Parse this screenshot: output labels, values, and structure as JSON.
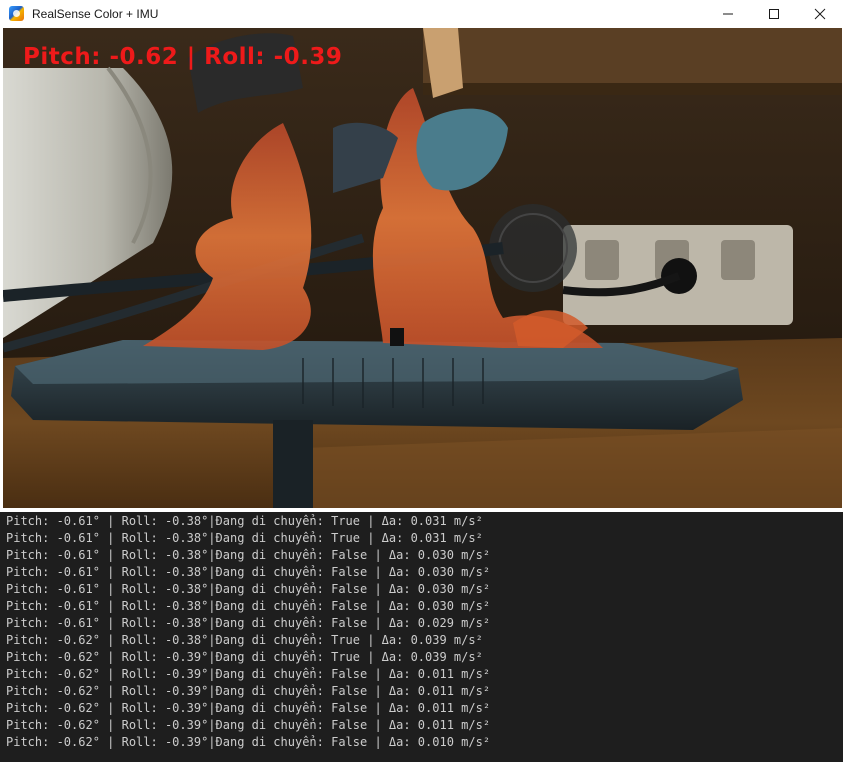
{
  "window": {
    "title": "RealSense Color + IMU",
    "controls": {
      "minimize_icon": "minimize-icon",
      "maximize_icon": "maximize-icon",
      "close_icon": "close-icon"
    }
  },
  "video": {
    "overlay": "Pitch: -0.62 | Roll: -0.39",
    "overlay_color": "#ee1a1a"
  },
  "console": {
    "lines": [
      "Pitch: -0.61° | Roll: -0.38°|Đang di chuyển: True | Δa: 0.031 m/s²",
      "Pitch: -0.61° | Roll: -0.38°|Đang di chuyển: True | Δa: 0.031 m/s²",
      "Pitch: -0.61° | Roll: -0.38°|Đang di chuyển: False | Δa: 0.030 m/s²",
      "Pitch: -0.61° | Roll: -0.38°|Đang di chuyển: False | Δa: 0.030 m/s²",
      "Pitch: -0.61° | Roll: -0.38°|Đang di chuyển: False | Δa: 0.030 m/s²",
      "Pitch: -0.61° | Roll: -0.38°|Đang di chuyển: False | Δa: 0.030 m/s²",
      "Pitch: -0.61° | Roll: -0.38°|Đang di chuyển: False | Δa: 0.029 m/s²",
      "Pitch: -0.62° | Roll: -0.38°|Đang di chuyển: True | Δa: 0.039 m/s²",
      "Pitch: -0.62° | Roll: -0.39°|Đang di chuyển: True | Δa: 0.039 m/s²",
      "Pitch: -0.62° | Roll: -0.39°|Đang di chuyển: False | Δa: 0.011 m/s²",
      "Pitch: -0.62° | Roll: -0.39°|Đang di chuyển: False | Δa: 0.011 m/s²",
      "Pitch: -0.62° | Roll: -0.39°|Đang di chuyển: False | Δa: 0.011 m/s²",
      "Pitch: -0.62° | Roll: -0.39°|Đang di chuyển: False | Δa: 0.011 m/s²",
      "Pitch: -0.62° | Roll: -0.39°|Đang di chuyển: False | Δa: 0.010 m/s²"
    ]
  }
}
